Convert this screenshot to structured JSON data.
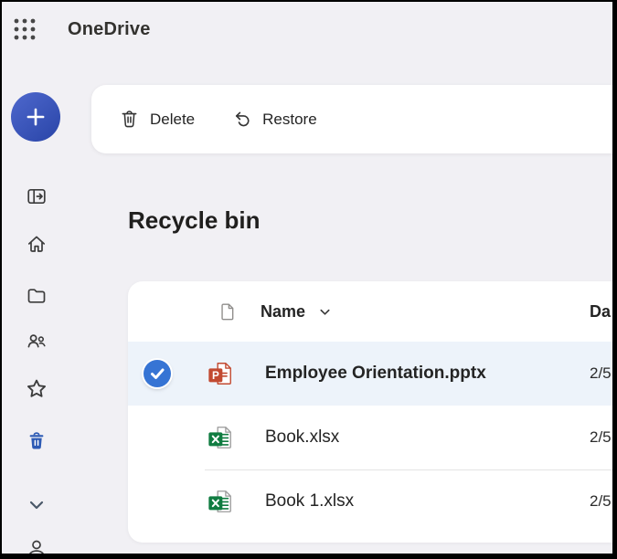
{
  "header": {
    "app_title": "OneDrive"
  },
  "toolbar": {
    "delete_label": "Delete",
    "restore_label": "Restore"
  },
  "page": {
    "title": "Recycle bin"
  },
  "sidebar": {
    "icons": [
      "add",
      "panel-toggle",
      "home",
      "my-files-folder",
      "shared-people",
      "favorites-star",
      "recycle-bin-trash",
      "chevron-down",
      "account-person"
    ],
    "active_item": "recycle-bin-trash"
  },
  "table": {
    "name_header": "Name",
    "date_header_partial": "Da",
    "rows": [
      {
        "name": "Employee Orientation.pptx",
        "file_type": "powerpoint",
        "date_deleted": "2/5",
        "selected": true
      },
      {
        "name": "Book.xlsx",
        "file_type": "excel",
        "date_deleted": "2/5",
        "selected": false
      },
      {
        "name": "Book 1.xlsx",
        "file_type": "excel",
        "date_deleted": "2/5",
        "selected": false
      }
    ]
  },
  "colors": {
    "background": "#f1f0f4",
    "fab_gradient_start": "#4e68cd",
    "fab_gradient_end": "#2d48ab",
    "active_nav_blue": "#2d5ab4",
    "selection_check_blue": "#3674d4",
    "selected_row_bg": "#edf3fa",
    "powerpoint_red": "#c24a31",
    "excel_green": "#107c41"
  }
}
